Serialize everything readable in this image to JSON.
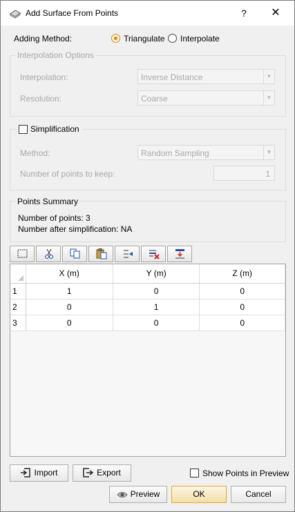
{
  "window": {
    "title": "Add Surface From Points",
    "help_glyph": "?",
    "close_glyph": "✕"
  },
  "adding_method": {
    "label": "Adding Method:",
    "options": [
      "Triangulate",
      "Interpolate"
    ],
    "selected": "Triangulate"
  },
  "interpolation_options": {
    "title": "Interpolation Options",
    "interpolation_label": "Interpolation:",
    "interpolation_value": "Inverse Distance",
    "resolution_label": "Resolution:",
    "resolution_value": "Coarse"
  },
  "simplification": {
    "title": "Simplification",
    "checked": false,
    "method_label": "Method:",
    "method_value": "Random Sampling",
    "points_label": "Number of points to keep:",
    "points_value": "1"
  },
  "points_summary": {
    "title": "Points Summary",
    "line1": "Number of points: 3",
    "line2": "Number after simplification: NA"
  },
  "toolbar": {
    "icons": [
      "select-all-icon",
      "cut-icon",
      "copy-icon",
      "paste-icon",
      "insert-row-icon",
      "delete-row-icon",
      "append-row-icon"
    ]
  },
  "table": {
    "columns": [
      "X (m)",
      "Y (m)",
      "Z (m)"
    ],
    "rows": [
      {
        "index": "1",
        "x": "1",
        "y": "0",
        "z": "0"
      },
      {
        "index": "2",
        "x": "0",
        "y": "1",
        "z": "0"
      },
      {
        "index": "3",
        "x": "0",
        "y": "0",
        "z": "0"
      }
    ]
  },
  "bottom": {
    "import_label": "Import",
    "export_label": "Export",
    "show_points_label": "Show Points in Preview",
    "show_points_checked": false,
    "preview_label": "Preview",
    "ok_label": "OK",
    "cancel_label": "Cancel"
  },
  "colors": {
    "accent": "#e3a82c",
    "disabled_text": "#a8a8a8",
    "dialog_bg": "#f0f0f0"
  }
}
